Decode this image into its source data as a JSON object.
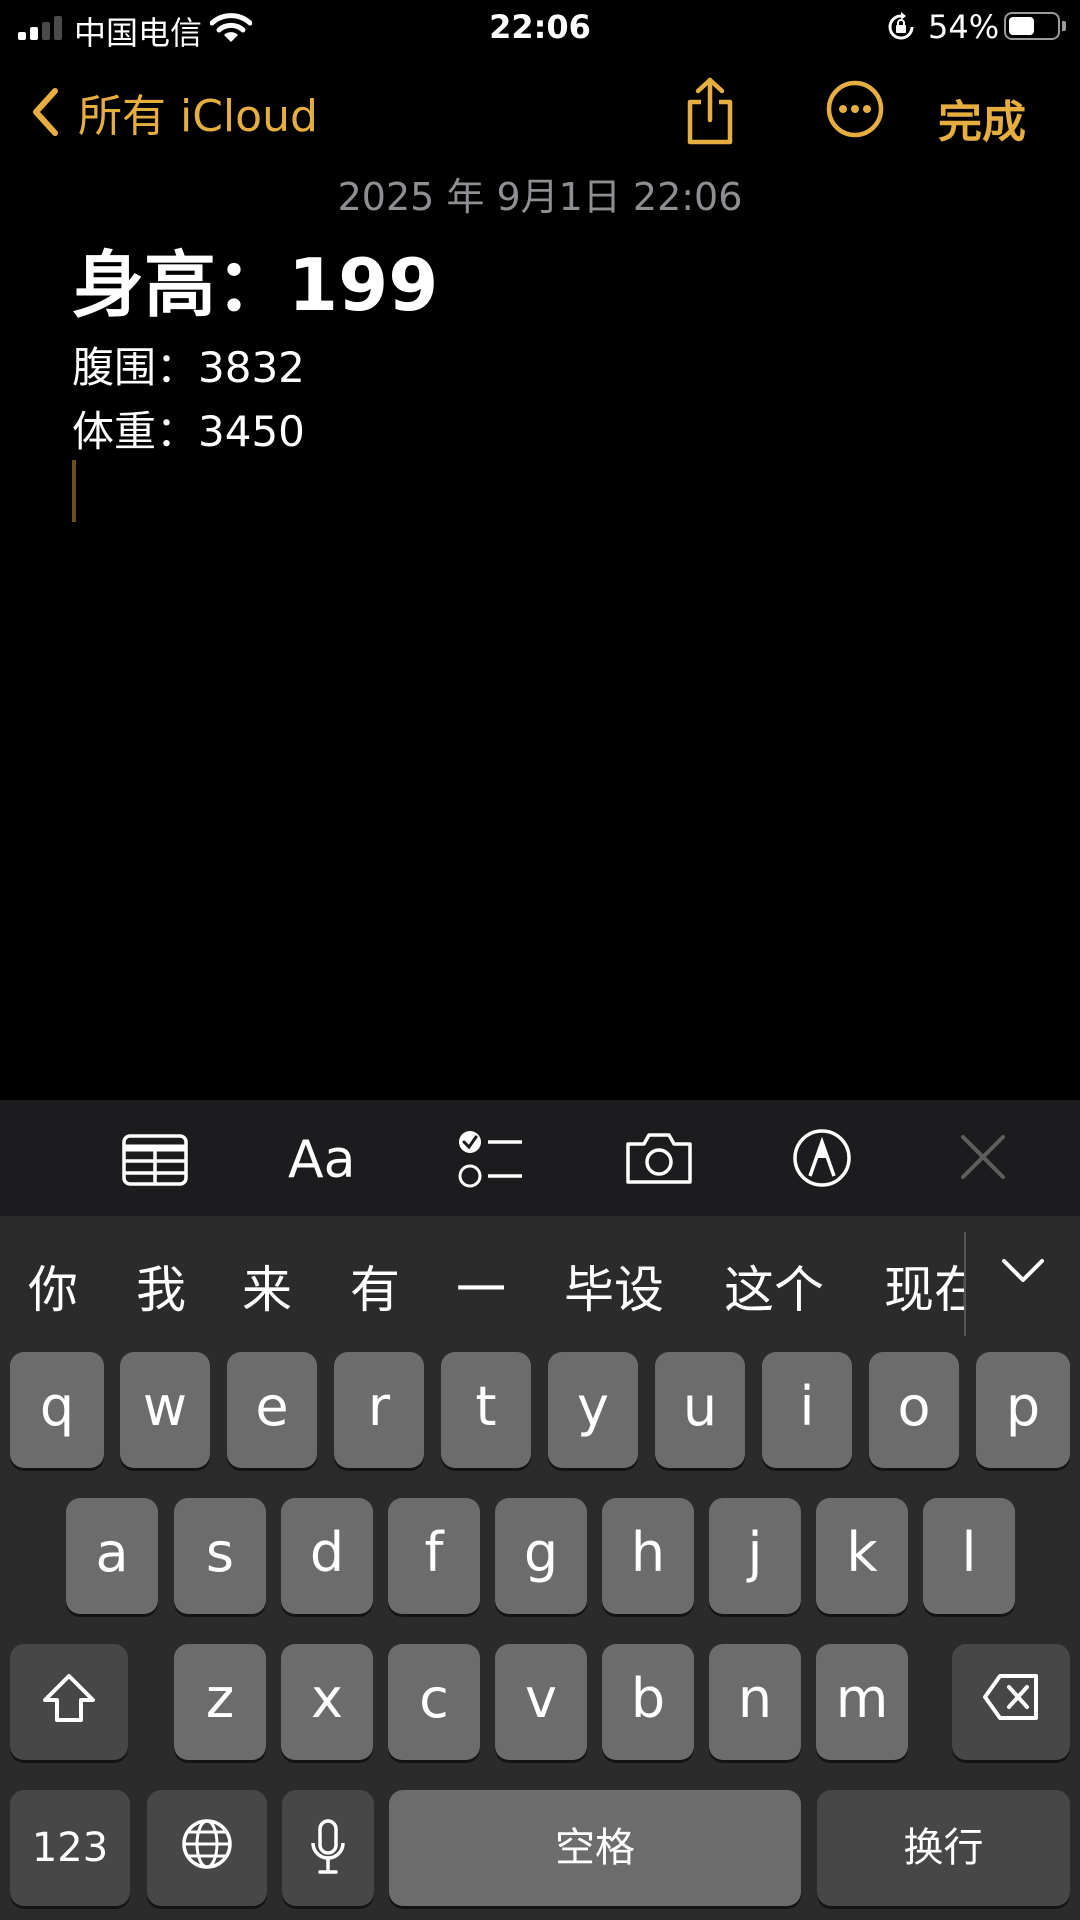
{
  "status_bar": {
    "carrier": "中国电信",
    "time": "22:06",
    "battery_percent": "54%",
    "battery_level": 0.54,
    "signal_bars": 2,
    "icons": [
      "signal-icon",
      "wifi-icon",
      "orientation-lock-icon",
      "battery-icon"
    ]
  },
  "nav": {
    "back_label": "所有 iCloud",
    "done_label": "完成",
    "accent_color": "#e5ae3f",
    "icons": [
      "chevron-left-icon",
      "share-icon",
      "more-icon"
    ]
  },
  "note": {
    "date": "2025 年 9月1日 22:06",
    "title": "身高：199",
    "lines": [
      "腹围：3832",
      "体重：3450"
    ]
  },
  "toolbar": {
    "format_label": "Aa",
    "icons": [
      "table-icon",
      "format-icon",
      "checklist-icon",
      "camera-icon",
      "markup-icon",
      "close-icon"
    ]
  },
  "keyboard": {
    "candidates": [
      "你",
      "我",
      "来",
      "有",
      "一",
      "毕设",
      "这个",
      "现在"
    ],
    "rows": [
      [
        "q",
        "w",
        "e",
        "r",
        "t",
        "y",
        "u",
        "i",
        "o",
        "p"
      ],
      [
        "a",
        "s",
        "d",
        "f",
        "g",
        "h",
        "j",
        "k",
        "l"
      ],
      [
        "z",
        "x",
        "c",
        "v",
        "b",
        "n",
        "m"
      ]
    ],
    "numbers_label": "123",
    "space_label": "空格",
    "return_label": "换行",
    "icons": [
      "shift-icon",
      "delete-icon",
      "globe-icon",
      "microphone-icon",
      "chevron-down-icon"
    ]
  }
}
